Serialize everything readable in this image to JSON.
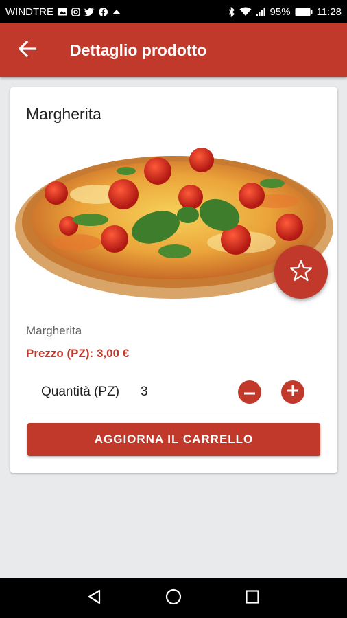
{
  "status_bar": {
    "carrier": "WINDTRE",
    "icons_left": [
      "gallery-icon",
      "instagram-icon",
      "twitter-icon",
      "facebook-icon",
      "cloud-icon"
    ],
    "icons_right": [
      "bluetooth-icon",
      "wifi-icon",
      "signal-icon"
    ],
    "battery": "95%",
    "time": "11:28"
  },
  "app_bar": {
    "title": "Dettaglio prodotto",
    "back_icon": "arrow-back-icon",
    "color": "#c0392b"
  },
  "product": {
    "title": "Margherita",
    "name": "Margherita",
    "price_text": "Prezzo (PZ): 3,00 €",
    "quantity_label": "Quantità (PZ)",
    "quantity": "3",
    "favorite_icon": "star-outline-icon",
    "decrease_icon": "minus-circle-icon",
    "increase_icon": "plus-circle-icon"
  },
  "actions": {
    "update_cart_label": "AGGIORNA IL CARRELLO"
  },
  "nav_bar": {
    "icons": [
      "back-triangle-icon",
      "home-circle-icon",
      "recents-square-icon"
    ]
  }
}
